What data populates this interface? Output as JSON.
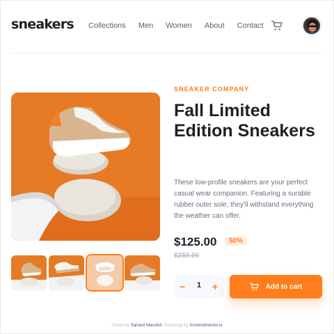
{
  "brand": {
    "logo": "sneakers"
  },
  "nav": {
    "items": [
      {
        "label": "Collections"
      },
      {
        "label": "Men"
      },
      {
        "label": "Women"
      },
      {
        "label": "About"
      },
      {
        "label": "Contact"
      }
    ]
  },
  "icons": {
    "cart": "cart-icon",
    "avatar": "avatar",
    "minus": "minus-icon",
    "plus": "plus-icon"
  },
  "product": {
    "company": "SNEAKER COMPANY",
    "title": "Fall Limited Edition Sneakers",
    "description": "These low-profile sneakers are your perfect casual wear companion. Featuring a surable rubber outer sole, they'll withstand everything the weather can offer.",
    "price": "$125.00",
    "discount": "50%",
    "original_price": "$250.00"
  },
  "cart_controls": {
    "minus": "−",
    "quantity": "1",
    "plus": "+",
    "add_label": "Add to cart"
  },
  "gallery": {
    "thumbnail_count": 4,
    "active_thumbnail": 3
  },
  "footer": {
    "coded_by": "Coded by",
    "author": "Sahand Masoleh",
    "challenge_by": ". Challenge by",
    "site": "frontendmentor.io"
  },
  "colors": {
    "accent": "#ff7e1b",
    "accent_pale": "#ffede0",
    "text_dark": "#1d2026",
    "text_grey": "#68707d"
  }
}
